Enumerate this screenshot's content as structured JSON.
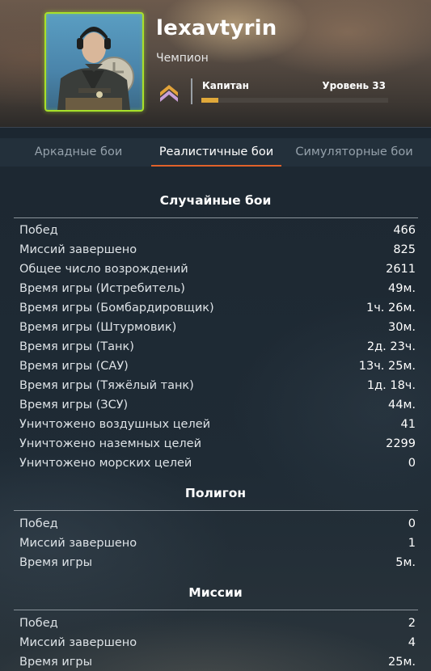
{
  "profile": {
    "username": "lexavtyrin",
    "title": "Чемпион",
    "rank": "Капитан",
    "level_text": "Уровень 33",
    "level_progress": 0.09,
    "frame_color": "#a8e02a",
    "rank_icon": "rank-chevron-icon"
  },
  "tabs": [
    {
      "label": "Аркадные бои",
      "active": false
    },
    {
      "label": "Реалистичные бои",
      "active": true
    },
    {
      "label": "Симуляторные бои",
      "active": false
    }
  ],
  "sections": [
    {
      "title": "Случайные бои",
      "rows": [
        {
          "label": "Побед",
          "value": "466"
        },
        {
          "label": "Миссий завершено",
          "value": "825"
        },
        {
          "label": "Общее число возрождений",
          "value": "2611"
        },
        {
          "label": "Время игры (Истребитель)",
          "value": "49м."
        },
        {
          "label": "Время игры (Бомбардировщик)",
          "value": "1ч. 26м."
        },
        {
          "label": "Время игры (Штурмовик)",
          "value": "30м."
        },
        {
          "label": "Время игры (Танк)",
          "value": "2д. 23ч."
        },
        {
          "label": "Время игры (САУ)",
          "value": "13ч. 25м."
        },
        {
          "label": "Время игры (Тяжёлый танк)",
          "value": "1д. 18ч."
        },
        {
          "label": "Время игры (ЗСУ)",
          "value": "44м."
        },
        {
          "label": "Уничтожено воздушных целей",
          "value": "41"
        },
        {
          "label": "Уничтожено наземных целей",
          "value": "2299"
        },
        {
          "label": "Уничтожено морских целей",
          "value": "0"
        }
      ]
    },
    {
      "title": "Полигон",
      "rows": [
        {
          "label": "Побед",
          "value": "0"
        },
        {
          "label": "Миссий завершено",
          "value": "1"
        },
        {
          "label": "Время игры",
          "value": "5м."
        }
      ]
    },
    {
      "title": "Миссии",
      "rows": [
        {
          "label": "Побед",
          "value": "2"
        },
        {
          "label": "Миссий завершено",
          "value": "4"
        },
        {
          "label": "Время игры",
          "value": "25м."
        }
      ]
    }
  ]
}
